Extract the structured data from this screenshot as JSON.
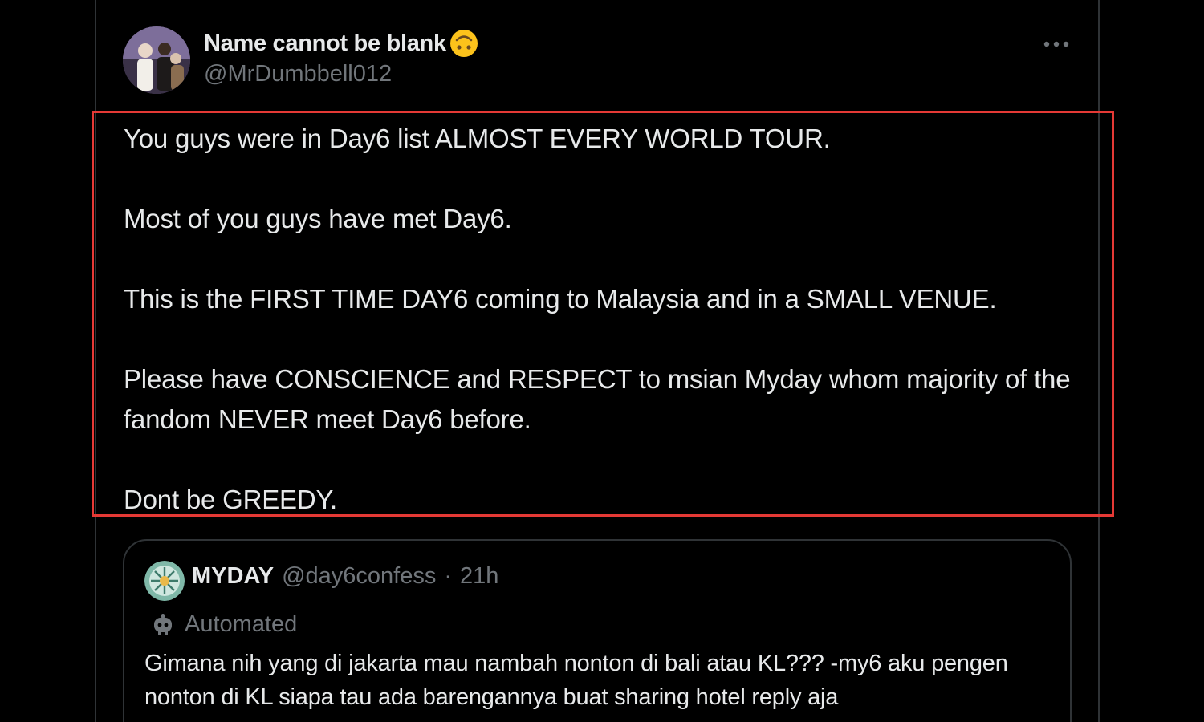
{
  "post": {
    "display_name": "Name cannot be blank",
    "name_emoji": "upside-down-face-emoji",
    "handle": "@MrDumbbell012",
    "more_icon": "more-dots-icon",
    "paragraphs": [
      "You guys were in Day6 list ALMOST EVERY WORLD TOUR.",
      "Most of you guys have met Day6.",
      "This is the FIRST TIME DAY6 coming to Malaysia and in a SMALL VENUE.",
      "Please have CONSCIENCE and RESPECT to msian Myday whom majority of the fandom NEVER meet Day6 before.",
      "Dont be GREEDY."
    ]
  },
  "highlight": {
    "color": "#e53935"
  },
  "quote": {
    "display_name": "MYDAY",
    "handle": "@day6confess",
    "separator": "·",
    "time": "21h",
    "automated_icon": "bot-icon",
    "automated_label": "Automated",
    "text": "Gimana nih yang di jakarta mau nambah nonton di bali atau KL??? -my6 aku pengen nonton di KL siapa tau ada barengannya buat sharing hotel reply aja"
  },
  "colors": {
    "background": "#000000",
    "text_primary": "#e7e9ea",
    "text_secondary": "#71767b",
    "border": "#2f3336"
  }
}
